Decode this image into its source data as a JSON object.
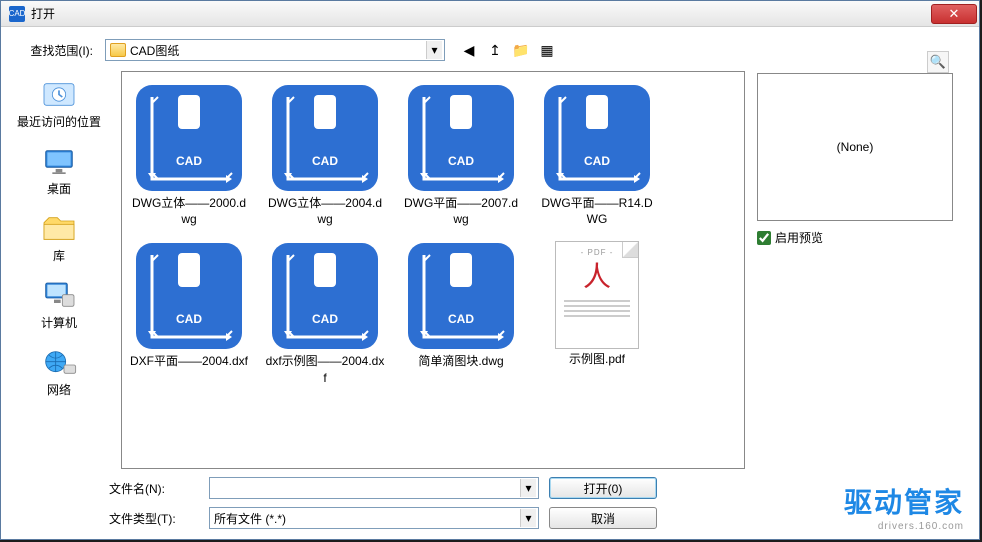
{
  "window": {
    "title": "打开",
    "close_glyph": "✕"
  },
  "toolbar": {
    "lookin_label": "查找范围(I):",
    "folder_name": "CAD图纸",
    "icons": {
      "back": "◀",
      "up": "↥",
      "new_folder": "📁",
      "view": "▦"
    }
  },
  "places": [
    {
      "key": "recent",
      "label": "最近访问的位置"
    },
    {
      "key": "desktop",
      "label": "桌面"
    },
    {
      "key": "libraries",
      "label": "库"
    },
    {
      "key": "computer",
      "label": "计算机"
    },
    {
      "key": "network",
      "label": "网络"
    }
  ],
  "files": [
    {
      "type": "cad",
      "name": "DWG立体——2000.dwg"
    },
    {
      "type": "cad",
      "name": "DWG立体——2004.dwg"
    },
    {
      "type": "cad",
      "name": "DWG平面——2007.dwg"
    },
    {
      "type": "cad",
      "name": "DWG平面——R14.DWG"
    },
    {
      "type": "cad",
      "name": "DXF平面——2004.dxf"
    },
    {
      "type": "cad",
      "name": "dxf示例图——2004.dxf"
    },
    {
      "type": "cad",
      "name": "简单滴图块.dwg"
    },
    {
      "type": "pdf",
      "name": "示例图.pdf",
      "pdf_tag": "PDF"
    }
  ],
  "preview": {
    "none_text": "(None)",
    "checkbox_label": "启用预览",
    "checked": true
  },
  "bottom": {
    "filename_label": "文件名(N):",
    "filename_value": "",
    "filetype_label": "文件类型(T):",
    "filetype_value": "所有文件 (*.*)",
    "open_btn": "打开(0)",
    "cancel_btn": "取消"
  },
  "watermark": {
    "cn": "驱动管家",
    "en": "drivers.160.com"
  },
  "search_icon": "🔍"
}
